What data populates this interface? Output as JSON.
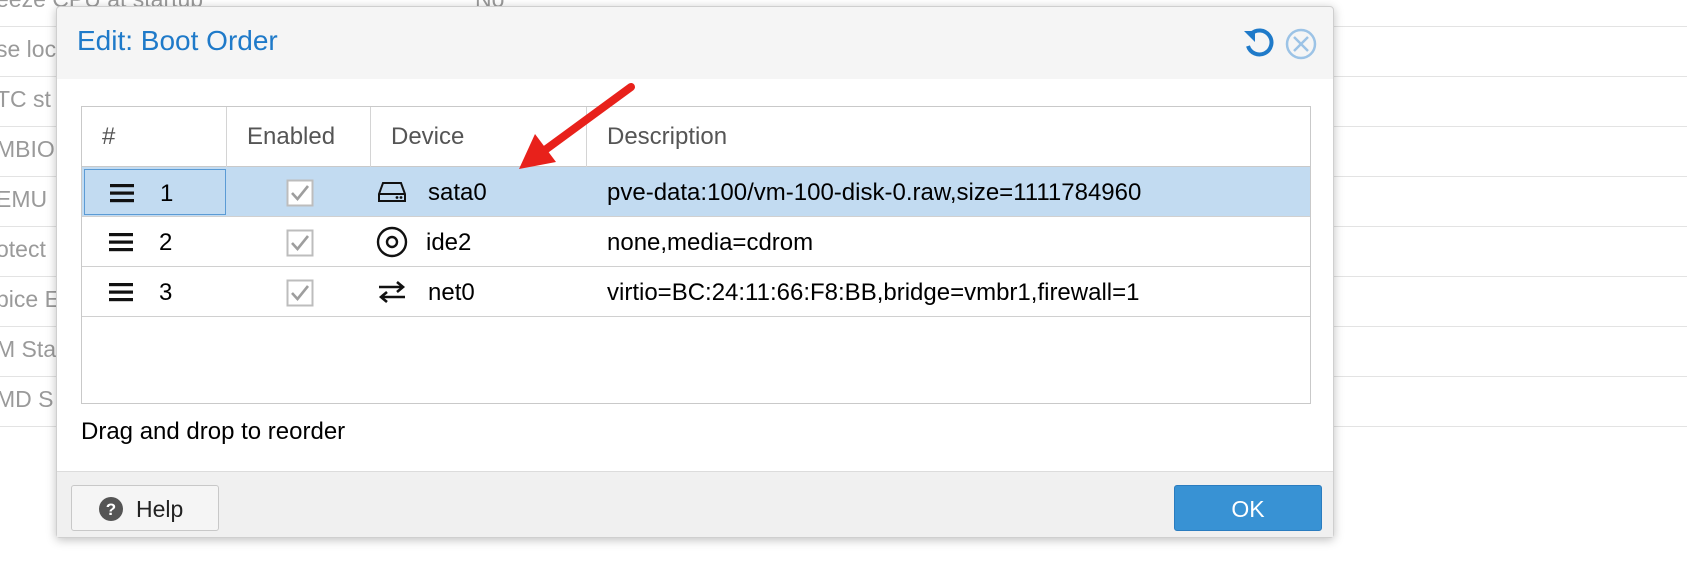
{
  "background": {
    "rows": [
      {
        "label": "eeze CPU at startup",
        "value": "No"
      },
      {
        "label": "se loc",
        "value": ""
      },
      {
        "label": "TC st",
        "value": ""
      },
      {
        "label": "MBIO",
        "value": ""
      },
      {
        "label": "EMU",
        "value": ""
      },
      {
        "label": "otect",
        "value": ""
      },
      {
        "label": "pice E",
        "value": ""
      },
      {
        "label": "M Sta",
        "value": ""
      },
      {
        "label": "MD S",
        "value": ""
      }
    ]
  },
  "dialog": {
    "title": "Edit: Boot Order",
    "header_icons": [
      "reset-icon",
      "close-icon"
    ],
    "columns": [
      "#",
      "Enabled",
      "Device",
      "Description"
    ],
    "rows": [
      {
        "num": "1",
        "enabled": true,
        "device_icon": "hard-disk-icon",
        "device": "sata0",
        "description": "pve-data:100/vm-100-disk-0.raw,size=1111784960",
        "selected": true
      },
      {
        "num": "2",
        "enabled": true,
        "device_icon": "cdrom-icon",
        "device": "ide2",
        "description": "none,media=cdrom",
        "selected": false
      },
      {
        "num": "3",
        "enabled": true,
        "device_icon": "network-icon",
        "device": "net0",
        "description": "virtio=BC:24:11:66:F8:BB,bridge=vmbr1,firewall=1",
        "selected": false
      }
    ],
    "hint": "Drag and drop to reorder",
    "help_label": "Help",
    "ok_label": "OK"
  },
  "colors": {
    "title": "#1f7ac9",
    "selected_row": "#c2dbf1",
    "ok_button": "#3892d4",
    "annotation_arrow": "#e8211b"
  }
}
